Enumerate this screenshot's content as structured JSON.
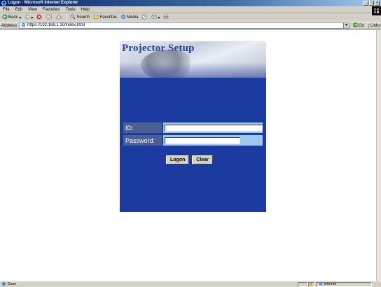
{
  "window": {
    "title": "Logon - Microsoft Internet Explorer",
    "min_label": "_",
    "max_label": "□",
    "close_label": "×"
  },
  "menu": [
    "File",
    "Edit",
    "View",
    "Favorites",
    "Tools",
    "Help"
  ],
  "toolbar": {
    "back_label": "Back",
    "search_label": "Search",
    "favorites_label": "Favorites",
    "media_label": "Media"
  },
  "address": {
    "label": "Address",
    "url": "https://192.168.1.10/index.html",
    "go_label": "Go",
    "links_label": "Links"
  },
  "page": {
    "title": "Projector Setup",
    "id_label": "ID:",
    "password_label": "Password:",
    "id_value": "",
    "password_value": "",
    "logon_label": "Logon",
    "clear_label": "Clear",
    "panel_color": "#1c3ba0",
    "field_bg_color": "#9ec8ee"
  },
  "status": {
    "text": "Done",
    "zone_label": "Internet"
  }
}
